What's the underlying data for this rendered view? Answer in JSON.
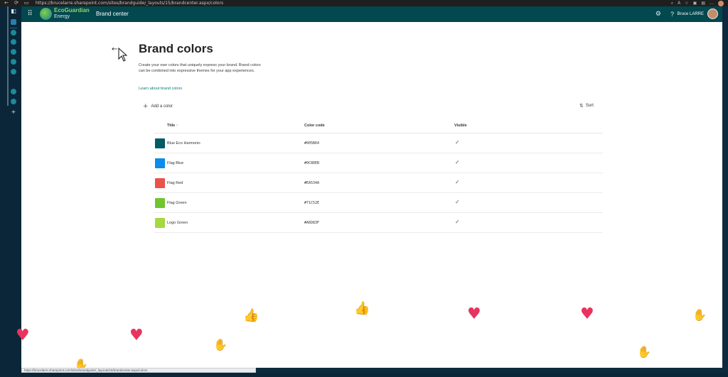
{
  "browser": {
    "url": "https://brucelarre.sharepoint.com/sites/brandguide/_layouts/15/brandcenter.aspx/colors",
    "back_glyph": "←",
    "refresh_glyph": "⟳",
    "tab_glyph": "▭"
  },
  "suitebar": {
    "brand_line1": "EcoGuardian",
    "brand_line2": "Energy",
    "title": "Brand center",
    "help_glyph": "?",
    "user_name": "Bruce LARRE"
  },
  "page": {
    "heading": "Brand colors",
    "description": "Create your own colors that uniquely express your brand. Brand colors can be combined into expressive themes for your app experiences.",
    "learn_link": "Learn about brand colors",
    "add_label": "Add a color",
    "sort_label": "Sort",
    "back_glyph": "←"
  },
  "table": {
    "col_title": "Title",
    "col_title_sort": "↑",
    "col_code": "Color code",
    "col_visible": "Visible",
    "rows": [
      {
        "title": "Blue Eco Harmonic",
        "code": "#005B64",
        "color": "#005B64",
        "visible": "✓"
      },
      {
        "title": "Flag Blue",
        "code": "#0C8DEB",
        "color": "#0C8DEB",
        "visible": "✓"
      },
      {
        "title": "Flag Red",
        "code": "#EA534A",
        "color": "#EA534A",
        "visible": "✓"
      },
      {
        "title": "Flag Green",
        "code": "#71C52E",
        "color": "#71C52E",
        "visible": "✓"
      },
      {
        "title": "Logo Green",
        "code": "#A6D83F",
        "color": "#A6D83F",
        "visible": "✓"
      }
    ]
  },
  "status_bar": "https://brucelarre.sharepoint.com/sites/brandguide/_layouts/15/brandcenter.aspx/colors"
}
